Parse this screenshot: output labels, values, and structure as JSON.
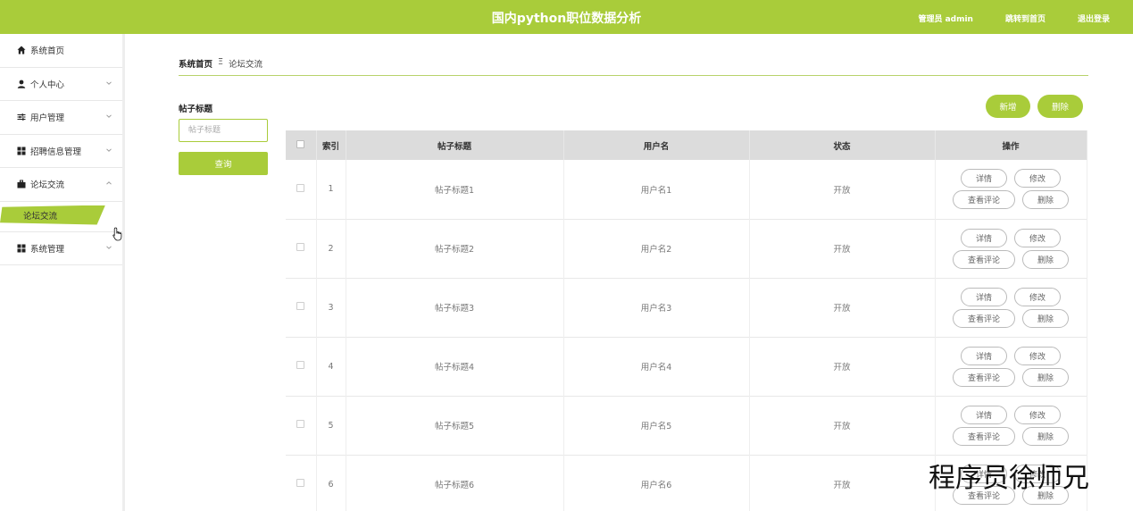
{
  "header": {
    "title": "国内python职位数据分析",
    "admin_label": "管理员 admin",
    "front_link": "跳转到首页",
    "logout": "退出登录"
  },
  "sidebar": {
    "items": [
      {
        "label": "系统首页",
        "icon": "home-icon"
      },
      {
        "label": "个人中心",
        "icon": "user-icon"
      },
      {
        "label": "用户管理",
        "icon": "sliders-icon"
      },
      {
        "label": "招聘信息管理",
        "icon": "grid-icon"
      },
      {
        "label": "论坛交流",
        "icon": "briefcase-icon"
      },
      {
        "label": "系统管理",
        "icon": "grid-icon"
      }
    ],
    "active_sub": "论坛交流"
  },
  "breadcrumb": {
    "home": "系统首页",
    "separator": "Ξ",
    "current": "论坛交流"
  },
  "filter": {
    "label": "帖子标题",
    "placeholder": "帖子标题",
    "search_button": "查询"
  },
  "toolbar": {
    "add": "新增",
    "delete": "删除"
  },
  "table": {
    "columns": [
      "索引",
      "帖子标题",
      "用户名",
      "状态",
      "操作"
    ],
    "rows": [
      {
        "index": "1",
        "title": "帖子标题1",
        "user": "用户名1",
        "status": "开放"
      },
      {
        "index": "2",
        "title": "帖子标题2",
        "user": "用户名2",
        "status": "开放"
      },
      {
        "index": "3",
        "title": "帖子标题3",
        "user": "用户名3",
        "status": "开放"
      },
      {
        "index": "4",
        "title": "帖子标题4",
        "user": "用户名4",
        "status": "开放"
      },
      {
        "index": "5",
        "title": "帖子标题5",
        "user": "用户名5",
        "status": "开放"
      },
      {
        "index": "6",
        "title": "帖子标题6",
        "user": "用户名6",
        "status": "开放"
      }
    ],
    "actions": {
      "detail": "详情",
      "edit": "修改",
      "comments": "查看评论",
      "remove": "删除"
    }
  },
  "watermark": "程序员徐师兄",
  "colors": {
    "accent": "#a9cc3a",
    "header_bg": "#a9cc3a",
    "table_head_bg": "#dcdcdc"
  }
}
